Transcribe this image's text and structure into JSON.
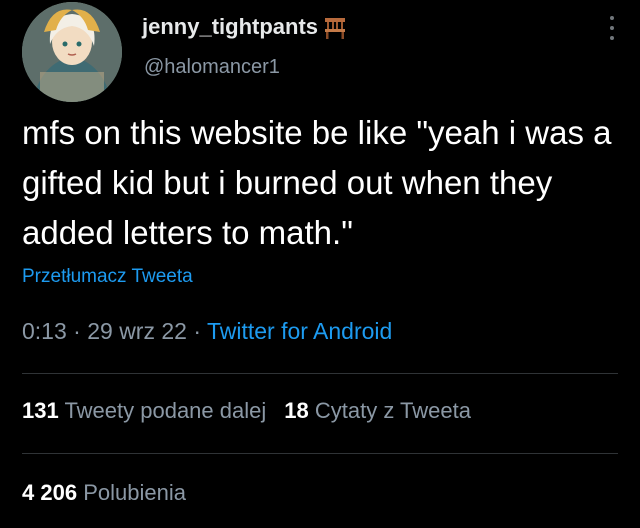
{
  "author": {
    "display_name": "jenny_tightpants",
    "handle": "@halomancer1",
    "name_emoji_icon": "chair-icon",
    "avatar_icon": "anime-character-avatar"
  },
  "tweet": {
    "text": "mfs on this website be like \"yeah i was a gifted kid but i burned out when they added letters to math.\""
  },
  "translate_link": "Przetłumacz Tweeta",
  "meta": {
    "time": "0:13",
    "separator1": " · ",
    "date": "29 wrz 22",
    "separator2": " · ",
    "source": "Twitter for Android"
  },
  "stats": {
    "retweets_count": "131",
    "retweets_label": "Tweety podane dalej",
    "quotes_count": "18",
    "quotes_label": "Cytaty z Tweeta",
    "likes_count": "4 206",
    "likes_label": "Polubienia"
  },
  "colors": {
    "background": "#000000",
    "link": "#1d9bf0",
    "secondary_text": "#8b98a5"
  }
}
